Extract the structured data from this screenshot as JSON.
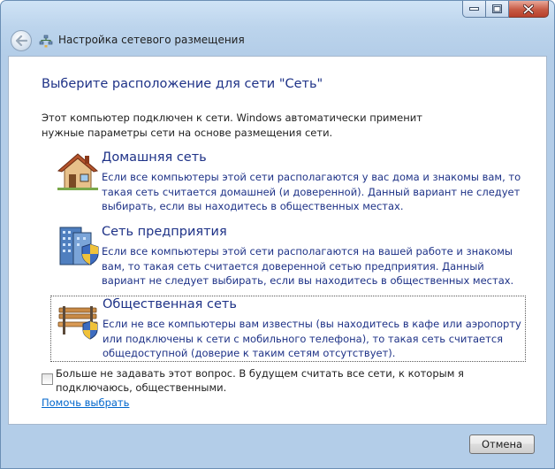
{
  "wizard": {
    "title": "Настройка сетевого размещения"
  },
  "page": {
    "heading": "Выберите расположение для сети \"Сеть\"",
    "intro": "Этот компьютер подключен к сети. Windows автоматически применит нужные параметры сети на основе размещения сети."
  },
  "options": [
    {
      "title": "Домашняя сеть",
      "description": "Если все компьютеры этой сети располагаются у вас дома и знакомы вам, то такая сеть считается домашней (и доверенной). Данный вариант не следует выбирать, если вы находитесь в общественных местах.",
      "icon": "home-icon"
    },
    {
      "title": "Сеть предприятия",
      "description": "Если все компьютеры этой сети располагаются на вашей работе и знакомы вам, то такая сеть считается доверенной сетью предприятия. Данный вариант не следует выбирать, если вы находитесь в общественных местах.",
      "icon": "office-building-icon"
    },
    {
      "title": "Общественная сеть",
      "description": "Если не все компьютеры вам известны (вы находитесь в кафе или аэропорту или подключены к сети с мобильного телефона), то такая сеть считается общедоступной (доверие к таким сетям отсутствует).",
      "icon": "park-bench-icon"
    }
  ],
  "dont_ask": {
    "label": "Больше не задавать этот вопрос. В будущем считать все сети, к которым я подключаюсь, общественными.",
    "checked": false
  },
  "help_link": "Помочь выбрать",
  "footer": {
    "cancel_label": "Отмена"
  },
  "colors": {
    "heading": "#1e3287",
    "link": "#0066cc",
    "close_button": "#c75a44"
  }
}
